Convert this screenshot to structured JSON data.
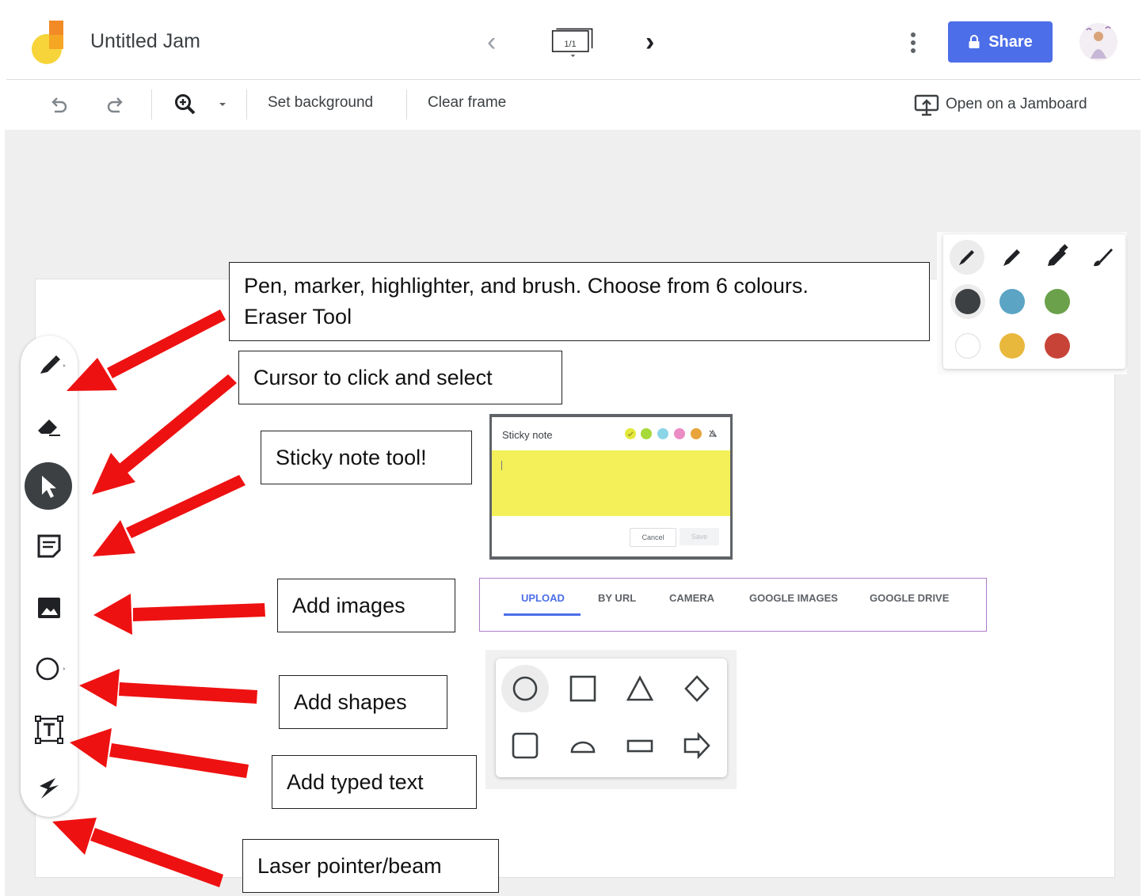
{
  "header": {
    "title": "Untitled Jam",
    "frame_counter": "1/1",
    "share_label": "Share"
  },
  "toolbar": {
    "set_background": "Set background",
    "clear_frame": "Clear frame",
    "open_on_jamboard": "Open on a Jamboard"
  },
  "callouts": {
    "pen_line1": "Pen, marker, highlighter, and brush. Choose from 6 colours.",
    "pen_line2": "Eraser Tool",
    "cursor": "Cursor to click and select",
    "sticky": "Sticky note tool!",
    "images": "Add images",
    "shapes": "Add shapes",
    "text": "Add typed text",
    "laser": "Laser pointer/beam"
  },
  "pen_panel": {
    "colors": [
      "#3c4043",
      "#5ba4c4",
      "#6aa14a",
      "#ffffff",
      "#e8b83c",
      "#c74337"
    ]
  },
  "sticky_note": {
    "title": "Sticky note",
    "cancel_label": "Cancel",
    "save_label": "Save",
    "colors": [
      "#e4e93c",
      "#a7d93a",
      "#8cd5e8",
      "#ec8cc4",
      "#e8a43a"
    ],
    "note_color": "#f4f05a"
  },
  "image_tabs": {
    "tabs": [
      "UPLOAD",
      "BY URL",
      "CAMERA",
      "GOOGLE IMAGES",
      "GOOGLE DRIVE"
    ],
    "active": "UPLOAD"
  },
  "colors": {
    "share_button": "#4c6ee8",
    "arrow": "#ee1111",
    "image_panel_border": "#b07cc8"
  }
}
